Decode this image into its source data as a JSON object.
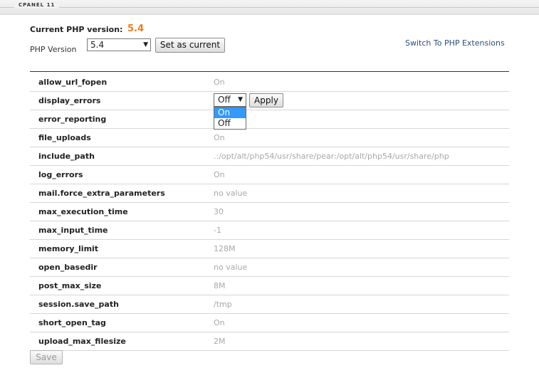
{
  "header": {
    "brand": "CPANEL 11"
  },
  "current": {
    "label": "Current PHP version:",
    "value": "5.4"
  },
  "version_select": {
    "label": "PHP Version",
    "value": "5.4",
    "button": "Set as current"
  },
  "extensions_link": "Switch To PHP Extensions",
  "rows": [
    {
      "name": "allow_url_fopen",
      "value": "On"
    },
    {
      "name": "display_errors",
      "value": ""
    },
    {
      "name": "error_reporting",
      "value": ""
    },
    {
      "name": "file_uploads",
      "value": "On"
    },
    {
      "name": "include_path",
      "value": ".:/opt/alt/php54/usr/share/pear:/opt/alt/php54/usr/share/php"
    },
    {
      "name": "log_errors",
      "value": "On"
    },
    {
      "name": "mail.force_extra_parameters",
      "value": "no value"
    },
    {
      "name": "max_execution_time",
      "value": "30"
    },
    {
      "name": "max_input_time",
      "value": "-1"
    },
    {
      "name": "memory_limit",
      "value": "128M"
    },
    {
      "name": "open_basedir",
      "value": "no value"
    },
    {
      "name": "post_max_size",
      "value": "8M"
    },
    {
      "name": "session.save_path",
      "value": "/tmp"
    },
    {
      "name": "short_open_tag",
      "value": "On"
    },
    {
      "name": "upload_max_filesize",
      "value": "2M"
    }
  ],
  "display_errors_edit": {
    "selected": "Off",
    "apply": "Apply",
    "options": [
      "On",
      "Off"
    ],
    "highlighted": "On"
  },
  "save_button": "Save",
  "colors": {
    "accent": "#f07a1a",
    "link": "#2a4f7a",
    "highlight": "#3399ff",
    "value_text": "#a8a8a8"
  }
}
